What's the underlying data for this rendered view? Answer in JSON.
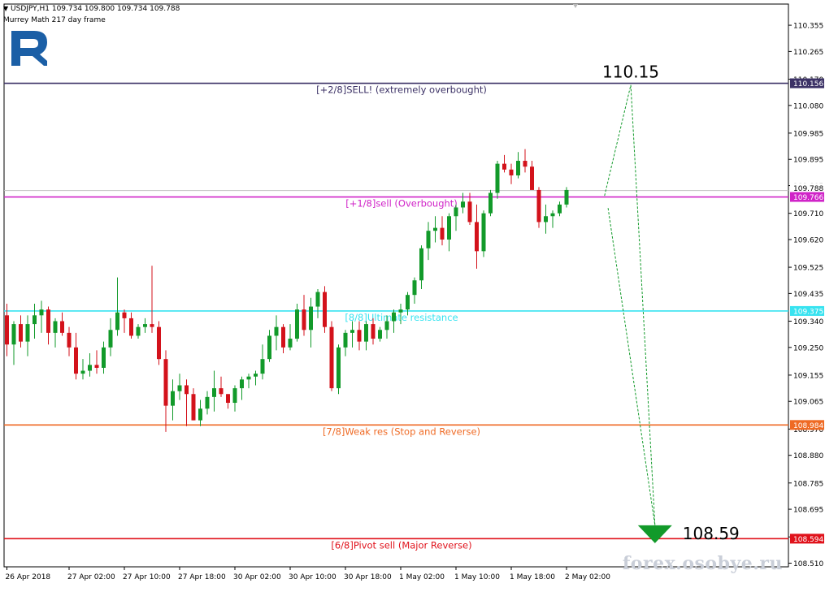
{
  "header": {
    "symbol_line": "USDJPY,H1  109.734 109.800 109.734 109.788",
    "indicator_line": "Murrey Math 217 day frame"
  },
  "watermark": "forex.osobye.ru",
  "colors": {
    "bull": "#129a2a",
    "bear": "#d3121b",
    "level_plus2": "#3c3266",
    "level_plus1": "#d024c8",
    "level_8": "#38e3f0",
    "level_7": "#ef6a24",
    "level_6": "#e0121b",
    "forecast": "#129a2a",
    "logo": "#1b5fa6"
  },
  "chart_data": {
    "type": "candlestick",
    "ylim": [
      108.48,
      110.44
    ],
    "y_ticks": [
      "110.355",
      "110.265",
      "110.170",
      "110.080",
      "109.985",
      "109.895",
      "109.805",
      "109.710",
      "109.620",
      "109.525",
      "109.435",
      "109.340",
      "109.250",
      "109.155",
      "109.065",
      "108.970",
      "108.880",
      "108.785",
      "108.695",
      "108.600",
      "108.510"
    ],
    "x_ticks": [
      "26 Apr 2018",
      "27 Apr 02:00",
      "27 Apr 10:00",
      "27 Apr 18:00",
      "30 Apr 02:00",
      "30 Apr 10:00",
      "30 Apr 18:00",
      "1 May 02:00",
      "1 May 10:00",
      "1 May 18:00",
      "2 May 02:00"
    ],
    "x_tick_index": [
      0,
      9,
      17,
      25,
      33,
      41,
      49,
      57,
      65,
      73,
      81
    ],
    "current_price_label": "109.788",
    "levels": [
      {
        "value": 110.156,
        "label": "[+2/8]SELL! (extremely overbought)",
        "tag": "110.156",
        "color_key": "level_plus2"
      },
      {
        "value": 109.766,
        "label": "[+1/8]sell (Overbought)",
        "tag": "109.766",
        "color_key": "level_plus1"
      },
      {
        "value": 109.375,
        "label": "[8/8]Ultimate resistance",
        "tag": "109.375",
        "color_key": "level_8"
      },
      {
        "value": 108.984,
        "label": "[7/8]Weak res (Stop and Reverse)",
        "tag": "108.984",
        "color_key": "level_7"
      },
      {
        "value": 108.594,
        "label": "[6/8]Pivot sell (Major Reverse)",
        "tag": "108.594",
        "color_key": "level_6"
      }
    ],
    "forecast": {
      "path": [
        {
          "bar": 86.5,
          "price": 109.77
        },
        {
          "bar": 90.3,
          "price": 110.15
        },
        {
          "bar": 93.8,
          "price": 108.64
        },
        {
          "bar": 87.0,
          "price": 109.73
        }
      ],
      "target_high": {
        "label": "110.15",
        "bar": 90.3,
        "price": 110.15
      },
      "target_low": {
        "label": "108.59",
        "bar": 93.8,
        "price": 108.64
      }
    },
    "candles": [
      [
        109.36,
        109.4,
        109.22,
        109.26
      ],
      [
        109.26,
        109.34,
        109.19,
        109.33
      ],
      [
        109.33,
        109.36,
        109.25,
        109.27
      ],
      [
        109.27,
        109.36,
        109.22,
        109.33
      ],
      [
        109.33,
        109.4,
        109.28,
        109.36
      ],
      [
        109.36,
        109.41,
        109.3,
        109.38
      ],
      [
        109.38,
        109.39,
        109.26,
        109.3
      ],
      [
        109.3,
        109.35,
        109.25,
        109.34
      ],
      [
        109.34,
        109.37,
        109.29,
        109.3
      ],
      [
        109.3,
        109.32,
        109.22,
        109.25
      ],
      [
        109.25,
        109.3,
        109.14,
        109.16
      ],
      [
        109.16,
        109.21,
        109.14,
        109.17
      ],
      [
        109.17,
        109.23,
        109.15,
        109.19
      ],
      [
        109.19,
        109.24,
        109.16,
        109.18
      ],
      [
        109.18,
        109.27,
        109.16,
        109.25
      ],
      [
        109.25,
        109.35,
        109.22,
        109.31
      ],
      [
        109.31,
        109.49,
        109.29,
        109.37
      ],
      [
        109.37,
        109.38,
        109.3,
        109.35
      ],
      [
        109.35,
        109.37,
        109.28,
        109.29
      ],
      [
        109.29,
        109.33,
        109.28,
        109.32
      ],
      [
        109.32,
        109.35,
        109.3,
        109.33
      ],
      [
        109.33,
        109.53,
        109.3,
        109.32
      ],
      [
        109.32,
        109.34,
        109.19,
        109.21
      ],
      [
        109.21,
        109.24,
        108.96,
        109.05
      ],
      [
        109.05,
        109.14,
        109.0,
        109.1
      ],
      [
        109.1,
        109.16,
        109.07,
        109.12
      ],
      [
        109.12,
        109.14,
        108.98,
        109.09
      ],
      [
        109.09,
        109.11,
        109.0,
        109.0
      ],
      [
        109.0,
        109.07,
        108.98,
        109.04
      ],
      [
        109.04,
        109.1,
        109.02,
        109.08
      ],
      [
        109.08,
        109.17,
        109.03,
        109.11
      ],
      [
        109.11,
        109.15,
        109.08,
        109.09
      ],
      [
        109.09,
        109.09,
        109.04,
        109.06
      ],
      [
        109.06,
        109.12,
        109.03,
        109.11
      ],
      [
        109.11,
        109.15,
        109.07,
        109.14
      ],
      [
        109.14,
        109.16,
        109.11,
        109.15
      ],
      [
        109.15,
        109.17,
        109.12,
        109.16
      ],
      [
        109.16,
        109.26,
        109.14,
        109.21
      ],
      [
        109.21,
        109.31,
        109.2,
        109.29
      ],
      [
        109.29,
        109.36,
        109.24,
        109.32
      ],
      [
        109.32,
        109.33,
        109.23,
        109.25
      ],
      [
        109.25,
        109.33,
        109.24,
        109.28
      ],
      [
        109.28,
        109.4,
        109.27,
        109.38
      ],
      [
        109.38,
        109.43,
        109.29,
        109.31
      ],
      [
        109.31,
        109.42,
        109.25,
        109.39
      ],
      [
        109.39,
        109.45,
        109.35,
        109.44
      ],
      [
        109.44,
        109.46,
        109.3,
        109.32
      ],
      [
        109.32,
        109.34,
        109.1,
        109.11
      ],
      [
        109.11,
        109.26,
        109.09,
        109.25
      ],
      [
        109.25,
        109.31,
        109.22,
        109.3
      ],
      [
        109.3,
        109.34,
        109.25,
        109.31
      ],
      [
        109.31,
        109.34,
        109.24,
        109.27
      ],
      [
        109.27,
        109.34,
        109.24,
        109.33
      ],
      [
        109.33,
        109.35,
        109.26,
        109.28
      ],
      [
        109.28,
        109.32,
        109.27,
        109.31
      ],
      [
        109.31,
        109.36,
        109.28,
        109.34
      ],
      [
        109.34,
        109.38,
        109.3,
        109.37
      ],
      [
        109.37,
        109.4,
        109.33,
        109.38
      ],
      [
        109.38,
        109.44,
        109.36,
        109.43
      ],
      [
        109.43,
        109.49,
        109.4,
        109.48
      ],
      [
        109.48,
        109.6,
        109.45,
        109.59
      ],
      [
        109.59,
        109.68,
        109.55,
        109.65
      ],
      [
        109.65,
        109.7,
        109.61,
        109.66
      ],
      [
        109.66,
        109.7,
        109.6,
        109.62
      ],
      [
        109.62,
        109.71,
        109.58,
        109.7
      ],
      [
        109.7,
        109.74,
        109.65,
        109.73
      ],
      [
        109.73,
        109.78,
        109.71,
        109.75
      ],
      [
        109.75,
        109.78,
        109.67,
        109.68
      ],
      [
        109.68,
        109.74,
        109.52,
        109.58
      ],
      [
        109.58,
        109.72,
        109.56,
        109.71
      ],
      [
        109.71,
        109.79,
        109.7,
        109.78
      ],
      [
        109.78,
        109.89,
        109.76,
        109.88
      ],
      [
        109.88,
        109.91,
        109.85,
        109.86
      ],
      [
        109.86,
        109.88,
        109.81,
        109.84
      ],
      [
        109.84,
        109.92,
        109.83,
        109.89
      ],
      [
        109.89,
        109.93,
        109.85,
        109.87
      ],
      [
        109.87,
        109.89,
        109.83,
        109.79
      ],
      [
        109.79,
        109.8,
        109.66,
        109.68
      ],
      [
        109.68,
        109.74,
        109.64,
        109.7
      ],
      [
        109.7,
        109.72,
        109.66,
        109.71
      ],
      [
        109.71,
        109.75,
        109.7,
        109.74
      ],
      [
        109.74,
        109.8,
        109.73,
        109.79
      ]
    ]
  }
}
